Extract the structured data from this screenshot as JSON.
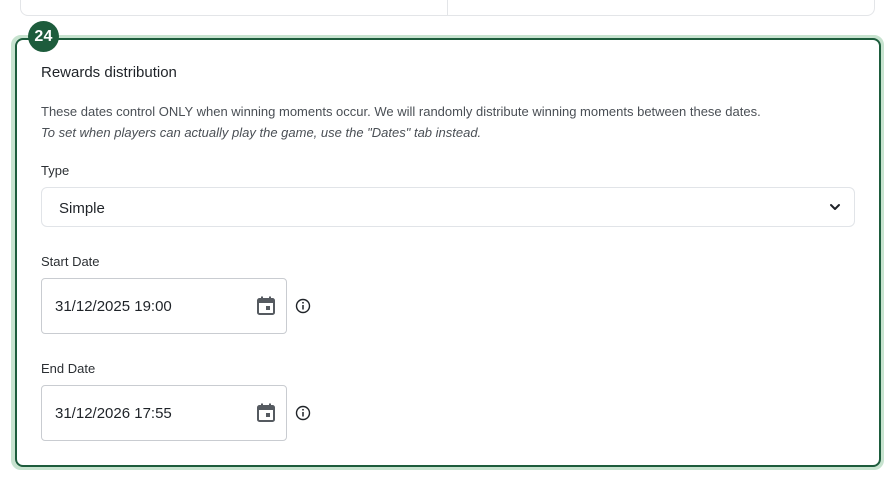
{
  "section": {
    "badge": "24",
    "title": "Rewards distribution",
    "description": "These dates control ONLY when winning moments occur. We will randomly distribute winning moments between these dates.",
    "note": "To set when players can actually play the game, use the \"Dates\" tab instead."
  },
  "type_field": {
    "label": "Type",
    "value": "Simple"
  },
  "start_date": {
    "label": "Start Date",
    "value": "31/12/2025 19:00"
  },
  "end_date": {
    "label": "End Date",
    "value": "31/12/2026 17:55"
  },
  "icons": {
    "select_chevron": "chevron-down-icon",
    "calendar": "calendar-icon",
    "info": "info-icon"
  },
  "colors": {
    "accent": "#1d5c3c",
    "accent_glow": "#c7e3cf",
    "border": "#e1e4e8",
    "text": "#1f2328",
    "muted_text": "#4a4f55"
  }
}
